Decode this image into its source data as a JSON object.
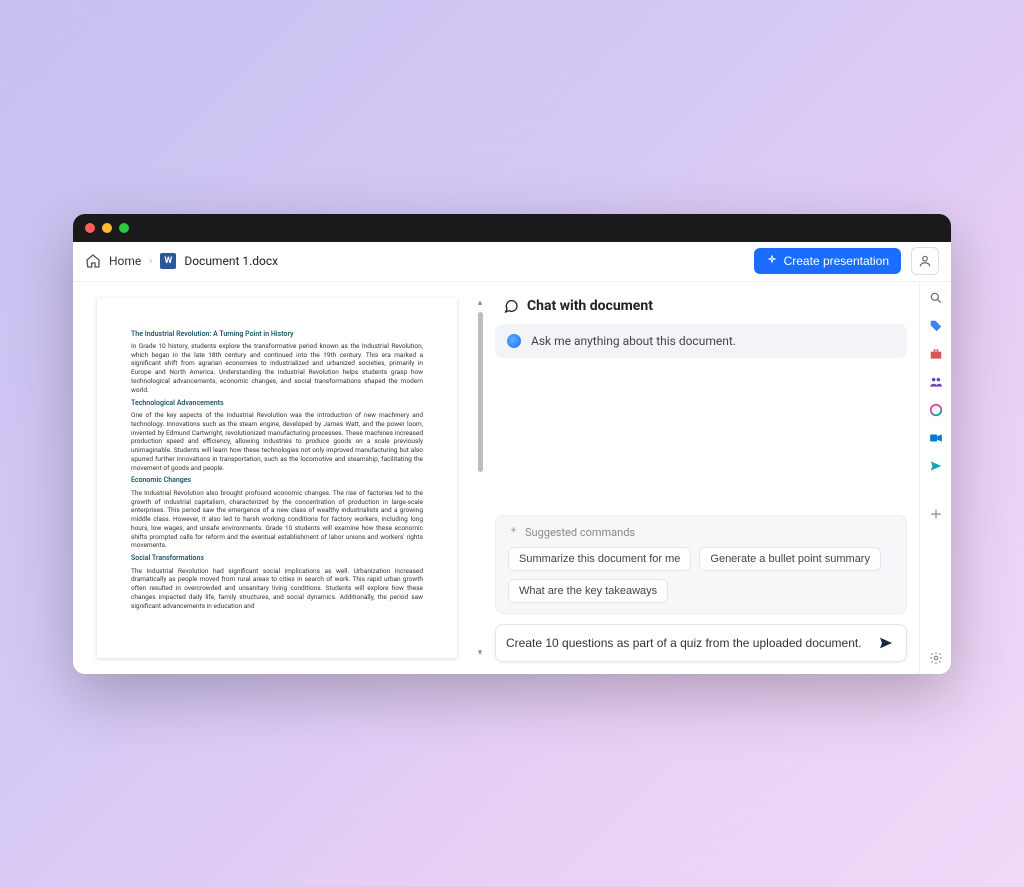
{
  "breadcrumb": {
    "home_label": "Home",
    "doc_name": "Document 1.docx"
  },
  "actions": {
    "create_presentation": "Create presentation"
  },
  "document": {
    "title": "The Industrial Revolution: A Turning Point in History",
    "para1": "In Grade 10 history, students explore the transformative period known as the Industrial Revolution, which began in the late 18th century and continued into the 19th century. This era marked a significant shift from agrarian economies to industrialized and urbanized societies, primarily in Europe and North America. Understanding the Industrial Revolution helps students grasp how technological advancements, economic changes, and social transformations shaped the modern world.",
    "h2": "Technological Advancements",
    "para2": "One of the key aspects of the Industrial Revolution was the introduction of new machinery and technology. Innovations such as the steam engine, developed by James Watt, and the power loom, invented by Edmund Cartwright, revolutionized manufacturing processes. These machines increased production speed and efficiency, allowing industries to produce goods on a scale previously unimaginable. Students will learn how these technologies not only improved manufacturing but also spurred further innovations in transportation, such as the locomotive and steamship, facilitating the movement of goods and people.",
    "h3": "Economic Changes",
    "para3": "The Industrial Revolution also brought profound economic changes. The rise of factories led to the growth of industrial capitalism, characterized by the concentration of production in large-scale enterprises. This period saw the emergence of a new class of wealthy industrialists and a growing middle class. However, it also led to harsh working conditions for factory workers, including long hours, low wages, and unsafe environments. Grade 10 students will examine how these economic shifts prompted calls for reform and the eventual establishment of labor unions and workers' rights movements.",
    "h4": "Social Transformations",
    "para4": "The Industrial Revolution had significant social implications as well. Urbanization increased dramatically as people moved from rural areas to cities in search of work. This rapid urban growth often resulted in overcrowded and unsanitary living conditions. Students will explore how these changes impacted daily life, family structures, and social dynamics. Additionally, the period saw significant advancements in education and"
  },
  "chat": {
    "title": "Chat with document",
    "greeting": "Ask me anything about this document.",
    "suggestions_label": "Suggested commands",
    "suggestions": [
      "Summarize this document for me",
      "Generate a bullet point summary",
      "What are the key takeaways"
    ],
    "composer_value": "Create 10 questions as part of a quiz from the uploaded document."
  },
  "rail_icons": [
    "search",
    "tag",
    "briefcase",
    "people",
    "copilot",
    "outlook",
    "send",
    "plus",
    "settings"
  ]
}
